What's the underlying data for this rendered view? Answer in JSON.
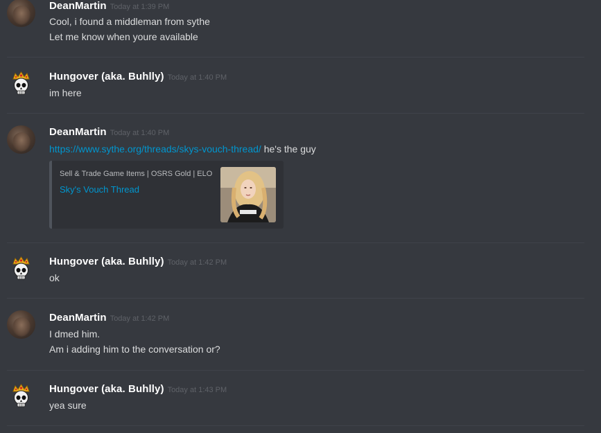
{
  "messages": [
    {
      "username": "DeanMartin",
      "timestamp": "Today at 1:39 PM",
      "lines": [
        "Cool, i found a middleman from sythe",
        "Let me know when youre available"
      ]
    },
    {
      "username": "Hungover (aka. Buhlly)",
      "timestamp": "Today at 1:40 PM",
      "lines": [
        "im here"
      ]
    },
    {
      "username": "DeanMartin",
      "timestamp": "Today at 1:40 PM",
      "link": "https://www.sythe.org/threads/skys-vouch-thread/",
      "link_suffix": " he's the guy",
      "embed": {
        "provider": "Sell & Trade Game Items | OSRS Gold | ELO",
        "title": "Sky's Vouch Thread"
      }
    },
    {
      "username": "Hungover (aka. Buhlly)",
      "timestamp": "Today at 1:42 PM",
      "lines": [
        "ok"
      ]
    },
    {
      "username": "DeanMartin",
      "timestamp": "Today at 1:42 PM",
      "lines": [
        "I dmed him.",
        "Am i adding him to the conversation or?"
      ]
    },
    {
      "username": "Hungover (aka. Buhlly)",
      "timestamp": "Today at 1:43 PM",
      "lines": [
        "yea sure"
      ]
    }
  ],
  "colors": {
    "background": "#36393f",
    "link": "#0096cf",
    "username": "#ffffff",
    "timestamp": "#5f6268",
    "embed_border": "#4f545c"
  }
}
